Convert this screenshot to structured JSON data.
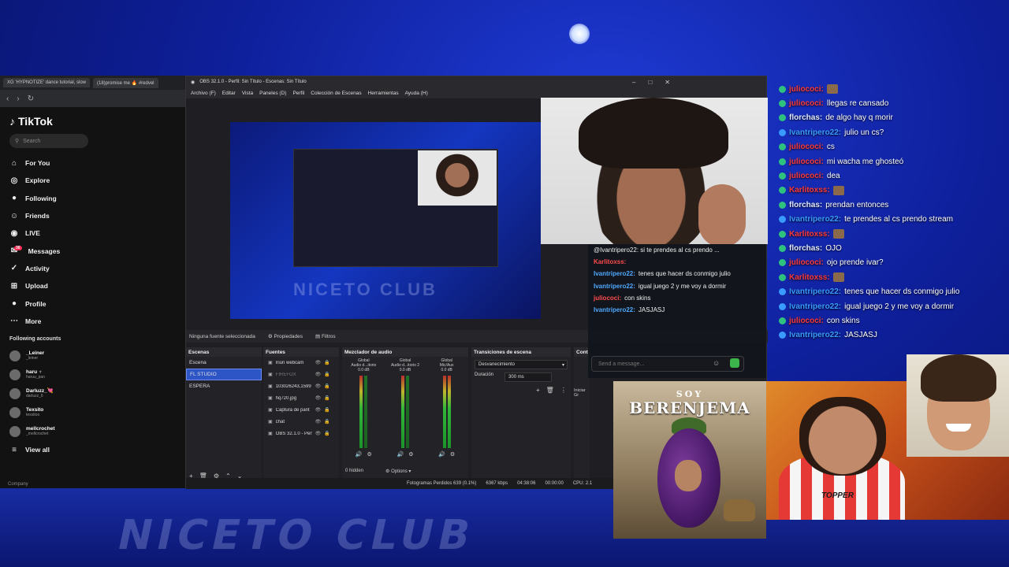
{
  "browser": {
    "tabs": [
      "XG 'HYPNOTIZE' dance tutorial, slow",
      "(18)promise me 🔥 #redvel"
    ]
  },
  "tiktok": {
    "logo": "TikTok",
    "search_placeholder": "Search",
    "nav": [
      {
        "icon": "home-icon",
        "glyph": "⌂",
        "label": "For You"
      },
      {
        "icon": "compass-icon",
        "glyph": "◎",
        "label": "Explore"
      },
      {
        "icon": "following-icon",
        "glyph": "●",
        "label": "Following"
      },
      {
        "icon": "friends-icon",
        "glyph": "☺",
        "label": "Friends"
      },
      {
        "icon": "live-icon",
        "glyph": "◉",
        "label": "LIVE"
      },
      {
        "icon": "messages-icon",
        "glyph": "✉",
        "label": "Messages",
        "badge": "36"
      },
      {
        "icon": "activity-icon",
        "glyph": "✓",
        "label": "Activity"
      },
      {
        "icon": "upload-icon",
        "glyph": "⊞",
        "label": "Upload"
      },
      {
        "icon": "profile-icon",
        "glyph": "●",
        "label": "Profile"
      },
      {
        "icon": "more-icon",
        "glyph": "⋯",
        "label": "More"
      }
    ],
    "following_title": "Following accounts",
    "accounts": [
      {
        "name": "_Leiner",
        "handle": "_leiner"
      },
      {
        "name": "haru ♆",
        "handle": "haruu_pan"
      },
      {
        "name": "Darluzz_💘",
        "handle": "darluzz_6"
      },
      {
        "name": "Texsito",
        "handle": "texsitoo"
      },
      {
        "name": "mellcrochet",
        "handle": "_mellcrochet"
      }
    ],
    "view_all": "View all",
    "company": "Company"
  },
  "obs": {
    "title": "OBS 32.1.0 - Perfil: Sin Título - Escenas: Sin Título",
    "menu": [
      "Archivo (F)",
      "Editar",
      "Vista",
      "Paneles (D)",
      "Perfil",
      "Colección de Escenas",
      "Herramientas",
      "Ayuda (H)"
    ],
    "no_source": "Ninguna fuente seleccionada",
    "properties": "Propiedades",
    "filters": "Filtros",
    "scenes_title": "Escena",
    "scenes_header": "Escenas",
    "scenes": [
      "Escena",
      "FL STUDIO",
      "ESPERA"
    ],
    "sources_header": "Fuentes",
    "sources": [
      {
        "name": "Iriun webcam",
        "dim": false
      },
      {
        "name": "FIREFOX",
        "dim": true
      },
      {
        "name": "103026243,1599",
        "dim": false
      },
      {
        "name": "hq720.jpg",
        "dim": false
      },
      {
        "name": "Captura de pant",
        "dim": false
      },
      {
        "name": "chat",
        "dim": false
      },
      {
        "name": "OBS 32.1.0 - Perfil: S...",
        "dim": false
      }
    ],
    "mixer_header": "Mezclador de audio",
    "mixer": [
      {
        "label": "Audio d...itorio",
        "global": "Global",
        "db": "0.0 dB"
      },
      {
        "label": "Audio d...itorio 2",
        "global": "Global",
        "db": "0.0 dB"
      },
      {
        "label": "Mic/Aux",
        "global": "Global",
        "db": "0.0 dB"
      }
    ],
    "mixer_hidden": "0 hidden",
    "mixer_options": "Options",
    "transitions_header": "Transiciones de escena",
    "transition": "Desvanecimiento",
    "duration_label": "Duración",
    "duration_value": "300 ms",
    "controls_header": "Cont",
    "controls_btn": "Iniciar Gr",
    "status": {
      "dropped": "Fotogramas Perdidos 639 (0.1%)",
      "bitrate": "6367 kbps",
      "rec_time": "04:38:06",
      "stream_time": "00:00:00",
      "cpu": "CPU: 2.1"
    },
    "preview_club": "NICETO CLUB"
  },
  "chat_popup": {
    "lines": [
      {
        "user": "",
        "msg": "@Ivantripero22: si te prendes al cs prendo ...",
        "red": false
      },
      {
        "user": "Karlitoxss:",
        "msg": "",
        "red": true
      },
      {
        "user": "Ivantripero22:",
        "msg": "tenes que hacer ds conmigo julio",
        "red": false
      },
      {
        "user": "Ivantripero22:",
        "msg": "igual juego 2 y me voy a dormir",
        "red": false
      },
      {
        "user": "juliococi:",
        "msg": "con skins",
        "red": true
      },
      {
        "user": "Ivantripero22:",
        "msg": "JASJASJ",
        "red": false
      }
    ],
    "input_placeholder": "Send a message..."
  },
  "chat_overlay": [
    {
      "user": "juliococi:",
      "msg": "",
      "color": "red",
      "emote": true
    },
    {
      "user": "juliococi:",
      "msg": "llegas re cansado",
      "color": "red",
      "emote": false
    },
    {
      "user": "florchas:",
      "msg": "de algo hay q morir",
      "color": "white",
      "emote": false
    },
    {
      "user": "Ivantripero22:",
      "msg": "julio un cs?",
      "color": "blue",
      "emote": false
    },
    {
      "user": "juliococi:",
      "msg": "cs",
      "color": "red",
      "emote": false
    },
    {
      "user": "juliococi:",
      "msg": "mi wacha me ghosteó",
      "color": "red",
      "emote": false
    },
    {
      "user": "juliococi:",
      "msg": "dea",
      "color": "red",
      "emote": false
    },
    {
      "user": "Karlitoxss:",
      "msg": "",
      "color": "red",
      "emote": true
    },
    {
      "user": "florchas:",
      "msg": "prendan entonces",
      "color": "white",
      "emote": false
    },
    {
      "user": "Ivantripero22:",
      "msg": "te prendes al cs prendo stream",
      "color": "blue",
      "emote": false
    },
    {
      "user": "Karlitoxss:",
      "msg": "",
      "color": "red",
      "emote": true
    },
    {
      "user": "florchas:",
      "msg": "OJO",
      "color": "white",
      "emote": false
    },
    {
      "user": "juliococi:",
      "msg": "ojo prende ivar?",
      "color": "red",
      "emote": false
    },
    {
      "user": "Karlitoxss:",
      "msg": "",
      "color": "red",
      "emote": true
    },
    {
      "user": "Ivantripero22:",
      "msg": "tenes que hacer ds conmigo julio",
      "color": "blue",
      "emote": false
    },
    {
      "user": "Ivantripero22:",
      "msg": "igual juego 2 y me voy a dormir",
      "color": "blue",
      "emote": false
    },
    {
      "user": "juliococi:",
      "msg": "con skins",
      "color": "red",
      "emote": false
    },
    {
      "user": "Ivantripero22:",
      "msg": "JASJASJ",
      "color": "blue",
      "emote": false
    }
  ],
  "thumbnails": {
    "berenjena_top": "SOY",
    "berenjena_title": "BERENJEMA",
    "shirt_brand": "TOPPER"
  },
  "background": {
    "sign": "NICETO CLUB"
  },
  "colors": {
    "obs_selected": "#2d55c5",
    "chat_red": "#ff3a3a",
    "chat_blue": "#3a9bff"
  }
}
